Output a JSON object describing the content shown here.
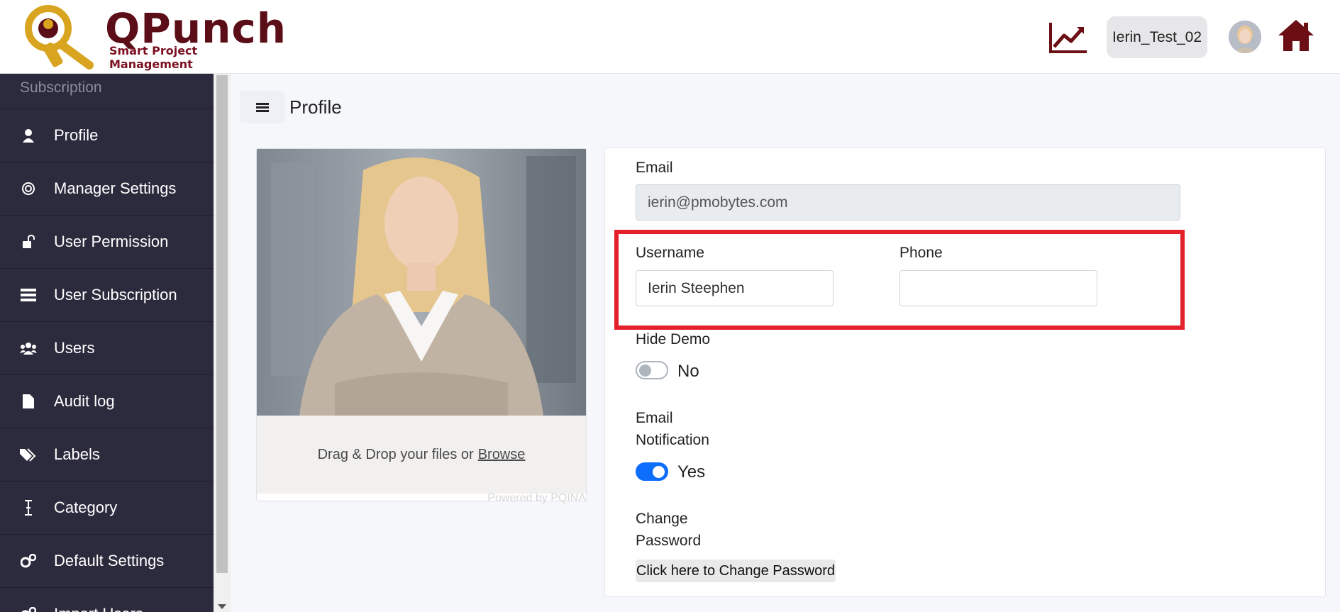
{
  "header": {
    "brand_name": "QPunch",
    "brand_tagline": "Smart Project Management",
    "username_chip": "Ierin_Test_02",
    "icons": [
      "trending-chart-icon",
      "avatar",
      "home-icon"
    ],
    "brand_color": "#5b0d18"
  },
  "sidebar": {
    "section_label": "Subscription",
    "items": [
      {
        "label": "Profile",
        "icon": "user-icon"
      },
      {
        "label": "Manager Settings",
        "icon": "swirl-icon"
      },
      {
        "label": "User Permission",
        "icon": "unlock-icon"
      },
      {
        "label": "User Subscription",
        "icon": "list-icon"
      },
      {
        "label": "Users",
        "icon": "users-icon"
      },
      {
        "label": "Audit log",
        "icon": "file-icon"
      },
      {
        "label": "Labels",
        "icon": "tags-icon"
      },
      {
        "label": "Category",
        "icon": "text-cursor-icon"
      },
      {
        "label": "Default Settings",
        "icon": "gears-icon"
      },
      {
        "label": "Import Users",
        "icon": "gears-icon"
      }
    ],
    "background": "#2c2b3e"
  },
  "page": {
    "title": "Profile"
  },
  "upload": {
    "drop_text": "Drag & Drop your files or",
    "browse_label": "Browse",
    "powered_by": "Powered by PQINA"
  },
  "form": {
    "email_label": "Email",
    "email_value": "ierin@pmobytes.com",
    "username_label": "Username",
    "username_value": "Ierin Steephen",
    "phone_label": "Phone",
    "phone_value": "",
    "hide_demo_label": "Hide Demo",
    "hide_demo_state": "No",
    "email_notification_label_line1": "Email",
    "email_notification_label_line2": "Notification",
    "email_notification_state": "Yes",
    "change_password_label_line1": "Change",
    "change_password_label_line2": "Password",
    "change_password_button": "Click here to Change Password"
  },
  "colors": {
    "highlight": "#e3212c",
    "toggle_on": "#0d6efd"
  }
}
